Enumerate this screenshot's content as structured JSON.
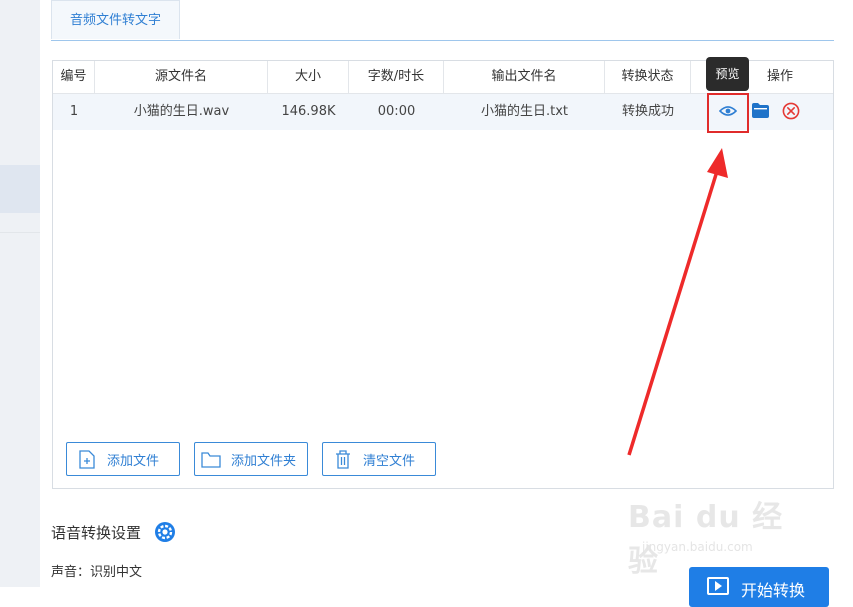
{
  "tab": {
    "label": "音频文件转文字"
  },
  "table": {
    "headers": [
      "编号",
      "源文件名",
      "大小",
      "字数/时长",
      "输出文件名",
      "转换状态",
      "操作"
    ],
    "rows": [
      {
        "index": "1",
        "source": "小猫的生日.wav",
        "size": "146.98K",
        "duration": "00:00",
        "output": "小猫的生日.txt",
        "status": "转换成功"
      }
    ]
  },
  "tooltip": {
    "text": "预览"
  },
  "buttons": {
    "add_file": "添加文件",
    "add_folder": "添加文件夹",
    "clear": "清空文件"
  },
  "settings": {
    "title": "语音转换设置",
    "voice_label": "声音：识别中文"
  },
  "start": {
    "label": "开始转换"
  },
  "watermark": {
    "brand": "Bai du 经验",
    "url": "jingyan.baidu.com"
  },
  "colors": {
    "accent": "#2f7fd3",
    "highlight": "#e02b2b",
    "delete": "#e53935"
  }
}
